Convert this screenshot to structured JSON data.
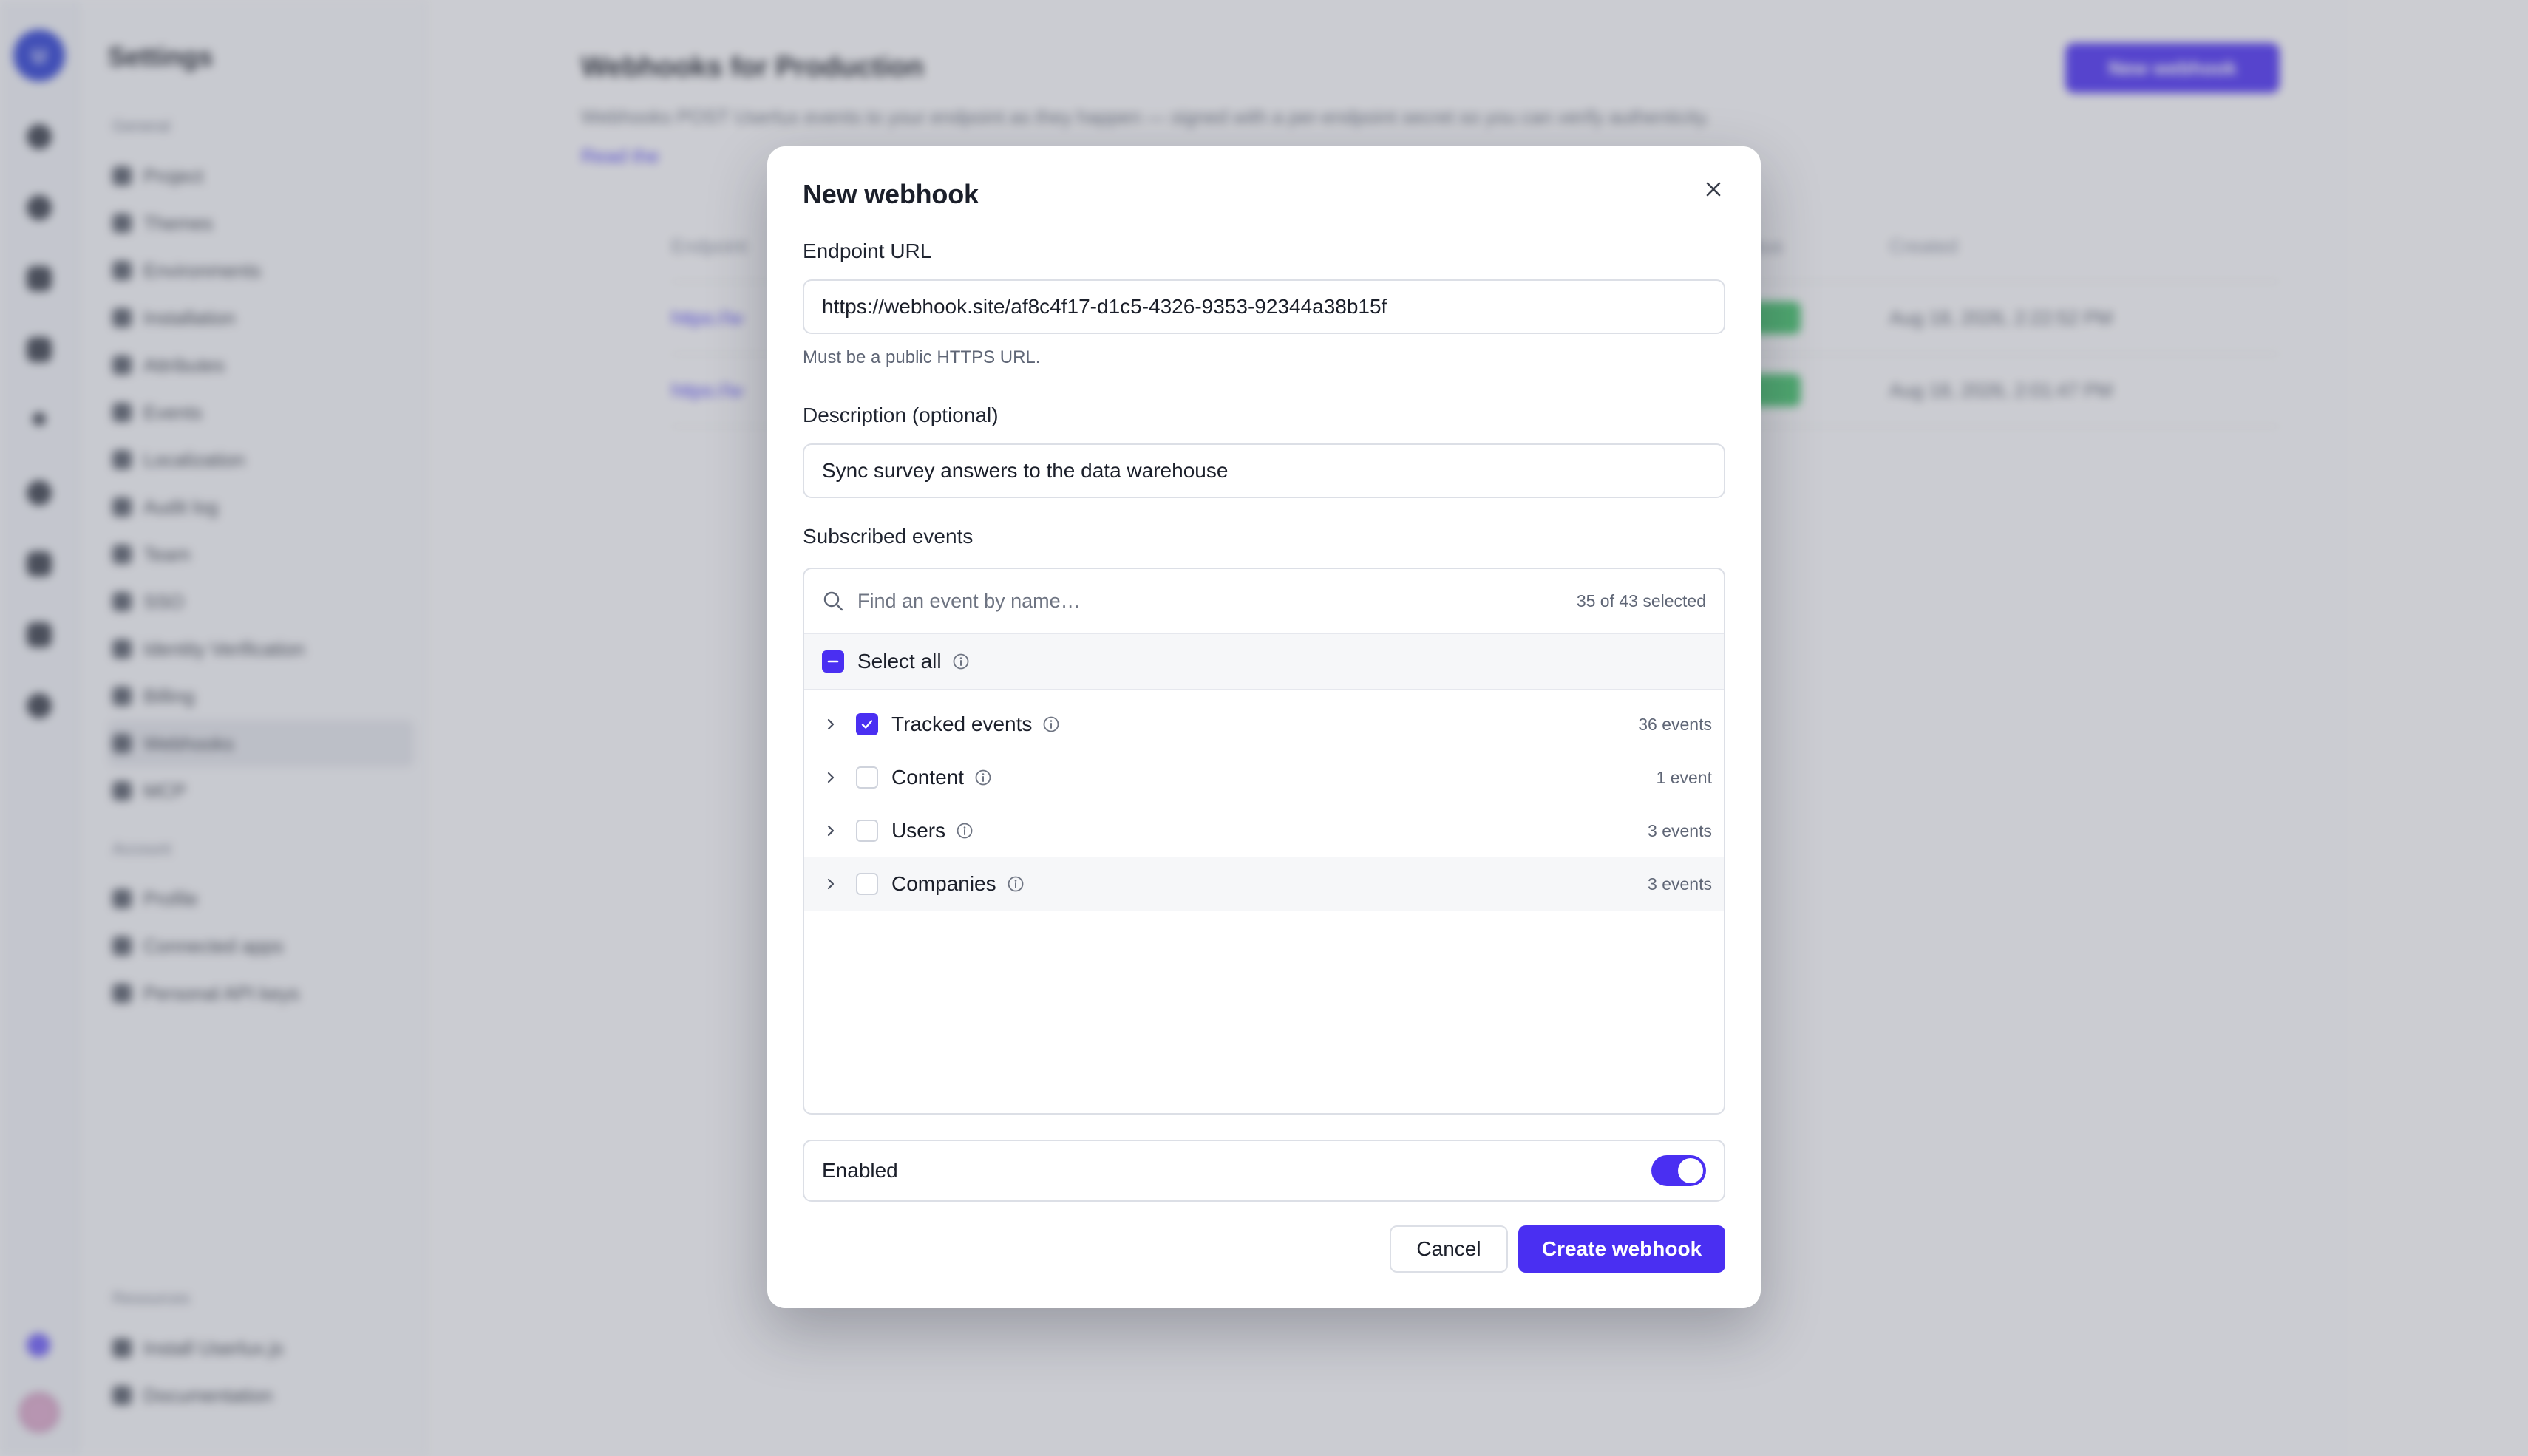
{
  "background": {
    "rail_logo": "U",
    "settings_title": "Settings",
    "groups": {
      "general": "General",
      "account": "Account",
      "resources": "Resources"
    },
    "general_items": [
      "Project",
      "Themes",
      "Environments",
      "Installation",
      "Attributes",
      "Events",
      "Localization",
      "Audit log",
      "Team",
      "SSO",
      "Identity Verification",
      "Billing",
      "Webhooks",
      "MCP"
    ],
    "account_items": [
      "Profile",
      "Connected apps",
      "Personal API keys"
    ],
    "resource_items": [
      "Install Userlux.js",
      "Documentation"
    ],
    "page_title": "Webhooks for Production",
    "page_desc": "Webhooks POST Userlux events to your endpoint as they happen — signed with a per-endpoint secret so you can verify authenticity.",
    "page_link": "Read the",
    "new_webhook_label": "New webhook",
    "table_headers": {
      "endpoint": "Endpoint",
      "status": "Status",
      "created": "Created"
    },
    "rows": [
      {
        "url": "https://w",
        "created": "Aug 18, 2026, 2:22:52 PM"
      },
      {
        "url": "https://w",
        "created": "Aug 18, 2026, 2:01:47 PM"
      }
    ]
  },
  "modal": {
    "title": "New webhook",
    "endpoint_label": "Endpoint URL",
    "endpoint_value": "https://webhook.site/af8c4f17-d1c5-4326-9353-92344a38b15f",
    "endpoint_hint": "Must be a public HTTPS URL.",
    "description_label": "Description (optional)",
    "description_value": "Sync survey answers to the data warehouse",
    "events_label": "Subscribed events",
    "search_placeholder": "Find an event by name…",
    "selected_count": "35 of 43 selected",
    "select_all_label": "Select all",
    "groups": [
      {
        "name": "Tracked events",
        "count": "36 events",
        "checked": true
      },
      {
        "name": "Content",
        "count": "1 event",
        "checked": false
      },
      {
        "name": "Users",
        "count": "3 events",
        "checked": false
      },
      {
        "name": "Companies",
        "count": "3 events",
        "checked": false
      }
    ],
    "enabled_label": "Enabled",
    "enabled": true,
    "cancel_label": "Cancel",
    "create_label": "Create webhook"
  },
  "colors": {
    "accent": "#4a2ff2",
    "scrim": "#707480",
    "status_active": "#3fbf68"
  }
}
